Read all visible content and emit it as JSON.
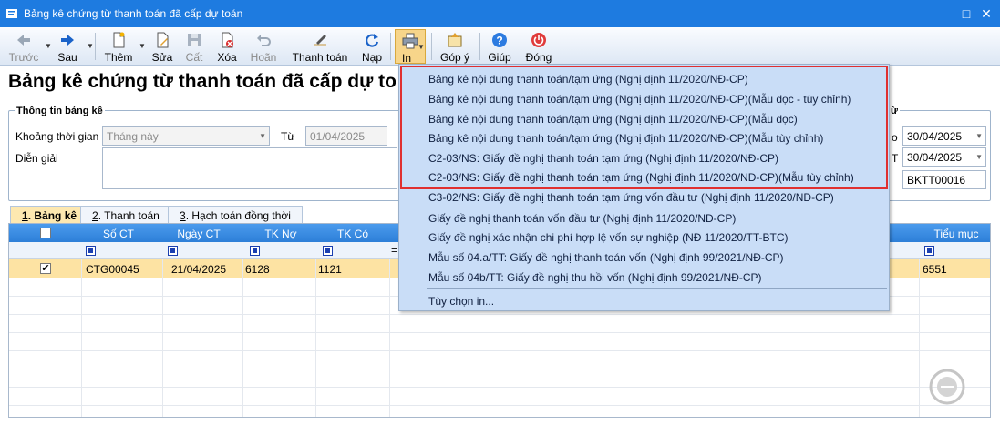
{
  "window": {
    "title": "Bảng kê chứng từ thanh toán đã cấp dự toán",
    "minimize_icon": "minimize-icon",
    "maximize_icon": "maximize-icon",
    "close_icon": "close-icon"
  },
  "toolbar": {
    "prev": "Trước",
    "next": "Sau",
    "add": "Thêm",
    "edit": "Sửa",
    "save": "Cất",
    "delete": "Xóa",
    "undo": "Hoãn",
    "pay": "Thanh toán",
    "reload": "Nạp",
    "print": "In",
    "feedback": "Góp ý",
    "help": "Giúp",
    "close": "Đóng"
  },
  "colors": {
    "titlebar": "#1e7be0",
    "grid_header": "#2d7fd8",
    "selected_row": "#fde3a3",
    "menu_bg": "#c9ddf7",
    "highlight_border": "#e03030"
  },
  "page": {
    "heading": "Bảng kê chứng từ thanh toán đã cấp dự toán"
  },
  "info": {
    "group_title": "Thông tin bảng kê",
    "period_label": "Khoảng thời gian",
    "period_value": "Tháng này",
    "from_label": "Từ",
    "from_value": "01/04/2025",
    "note_label": "Diễn giải",
    "to_label_frag": "o",
    "to_value": "30/04/2025",
    "date_label_frag": "T",
    "date_value": "30/04/2025",
    "number_value": "BKTT00016",
    "right_group_frag": "ừ"
  },
  "tabs": [
    {
      "key": "1",
      "label": ". Bảng kê"
    },
    {
      "key": "2",
      "label": ". Thanh toán"
    },
    {
      "key": "3",
      "label": ". Hạch toán đồng thời"
    }
  ],
  "grid": {
    "columns": [
      "Số CT",
      "Ngày CT",
      "TK Nợ",
      "TK Có",
      "Tiểu mục"
    ],
    "filter_equals": "=",
    "rows": [
      {
        "checked": "✔",
        "so_ct": "CTG00045",
        "ngay_ct": "21/04/2025",
        "tk_no": "6128",
        "tk_co": "1121",
        "tieu_muc": "6551"
      }
    ]
  },
  "print_menu": {
    "items": [
      "Bảng kê nội dung thanh toán/tạm ứng (Nghị định 11/2020/NĐ-CP)",
      "Bảng kê nội dung thanh toán/tạm ứng (Nghị định 11/2020/NĐ-CP)(Mẫu dọc - tùy chỉnh)",
      "Bảng kê nội dung thanh toán/tạm ứng (Nghị định 11/2020/NĐ-CP)(Mẫu dọc)",
      "Bảng kê nội dung thanh toán/tạm ứng (Nghị định 11/2020/NĐ-CP)(Mẫu tùy chỉnh)",
      "C2-03/NS: Giấy đề nghị thanh toán tạm ứng (Nghị định 11/2020/NĐ-CP)",
      "C2-03/NS: Giấy đề nghị thanh toán tạm ứng (Nghị định 11/2020/NĐ-CP)(Mẫu tùy chỉnh)",
      "C3-02/NS: Giấy đề nghị thanh toán tạm ứng vốn đầu tư (Nghị định 11/2020/NĐ-CP)",
      "Giấy đề nghị thanh toán vốn đầu tư (Nghị định 11/2020/NĐ-CP)",
      "Giấy đề nghị xác nhận chi phí hợp lệ vốn sự nghiệp (NĐ 11/2020/TT-BTC)",
      "Mẫu số 04.a/TT: Giấy đề nghị thanh toán vốn (Nghị định 99/2021/NĐ-CP)",
      "Mẫu số 04b/TT: Giấy đề nghị thu hồi vốn (Nghị định 99/2021/NĐ-CP)"
    ],
    "options": "Tùy chọn in..."
  }
}
